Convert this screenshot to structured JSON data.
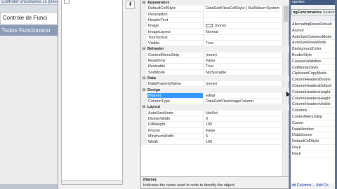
{
  "left_panel": {
    "tab_label": "ControleFuncionarios.cs [Desi",
    "form_label": "Controle de Funci",
    "title": "Todos Funcionário"
  },
  "editor": {
    "arrow_button": "⬇",
    "categories": {
      "appearance": "Appearance",
      "behavior": "Behavior",
      "data": "Data",
      "design": "Design",
      "layout": "Layout"
    },
    "appearance": [
      {
        "name": "DefaultCellStyle",
        "value": "DataGridViewCellStyle { NullValue=System"
      },
      {
        "name": "Description",
        "value": ""
      },
      {
        "name": "HeaderText",
        "value": ""
      },
      {
        "name": "Image",
        "value": "(none)"
      },
      {
        "name": "ImageLayout",
        "value": "Normal"
      },
      {
        "name": "ToolTipText",
        "value": ""
      },
      {
        "name": "Visible",
        "value": "True"
      }
    ],
    "behavior": [
      {
        "name": "ContextMenuStrip",
        "value": "(none)"
      },
      {
        "name": "ReadOnly",
        "value": "False"
      },
      {
        "name": "Resizable",
        "value": "True"
      },
      {
        "name": "SortMode",
        "value": "NotSortable"
      }
    ],
    "data": [
      {
        "name": "DataPropertyName",
        "value": "(none)"
      }
    ],
    "design": [
      {
        "name": "(Name)",
        "value": "editar"
      },
      {
        "name": "ColumnType",
        "value": "DataGridViewImageColumn"
      }
    ],
    "layout": [
      {
        "name": "AutoSizeMode",
        "value": "NotSet"
      },
      {
        "name": "DividerWidth",
        "value": "0"
      },
      {
        "name": "FillWeight",
        "value": "100"
      },
      {
        "name": "Frozen",
        "value": "False"
      },
      {
        "name": "MinimumWidth",
        "value": "5"
      },
      {
        "name": "Width",
        "value": "100"
      }
    ],
    "description": {
      "title": "(Name)",
      "text": "Indicates the name used in code to identify the object."
    }
  },
  "properties_panel": {
    "title": "operties",
    "object_name": "ngFuncionarios",
    "object_type": "System",
    "items": [
      "AlternatingRowsDefault",
      "Anchor",
      "AutoSizeColumnsMode",
      "AutoSizeRowsMode",
      "BackgroundColor",
      "BorderStyle",
      "CausesValidation",
      "CellBorderStyle",
      "ClipboardCopyMode",
      "ColumnHeadersBorder",
      "ColumnHeadersDefault",
      "ColumnHeadersHeight",
      "ColumnHeadersHeight",
      "ColumnHeadersVisible",
      "Columns",
      "ContextMenuStrip",
      "Cursor",
      "DataMember",
      "DataSource",
      "DefaultCellStyle",
      "Dock",
      "Dock"
    ],
    "link": "dit Columns..., Add Co"
  }
}
